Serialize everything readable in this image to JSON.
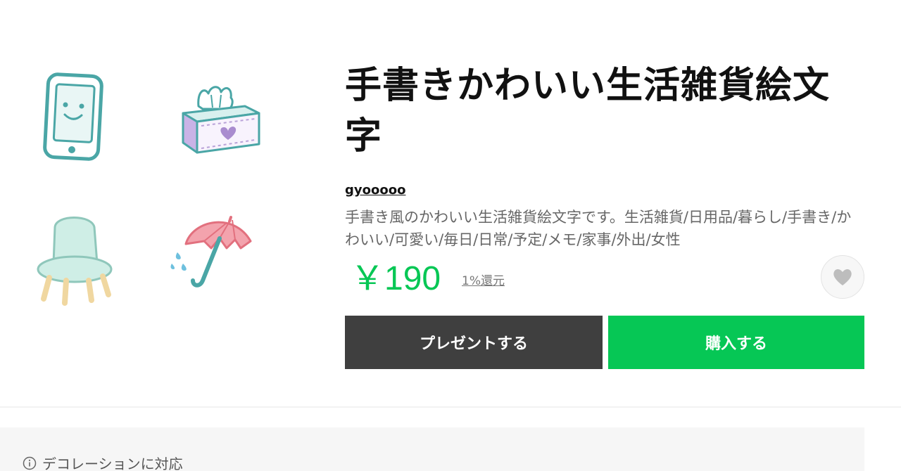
{
  "product": {
    "title": "手書きかわいい生活雑貨絵文字",
    "author": "gyooooo",
    "description": "手書き風のかわいい生活雑貨絵文字です。生活雑貨/日用品/暮らし/手書き/かわいい/可愛い/毎日/日常/予定/メモ/家事/外出/女性",
    "price": "￥190",
    "cashback": "1%還元"
  },
  "actions": {
    "gift_label": "プレゼントする",
    "buy_label": "購入する"
  },
  "notice": {
    "text": "デコレーションに対応"
  },
  "previews": [
    {
      "icon": "smartphone-sticker"
    },
    {
      "icon": "tissue-box-sticker"
    },
    {
      "icon": "chair-sticker"
    },
    {
      "icon": "umbrella-sticker"
    }
  ],
  "colors": {
    "accent": "#06c755",
    "gift_button": "#3f3f3f",
    "teal": "#4aa6a6",
    "pink": "#f08a96",
    "lavender": "#b9a2d8"
  }
}
